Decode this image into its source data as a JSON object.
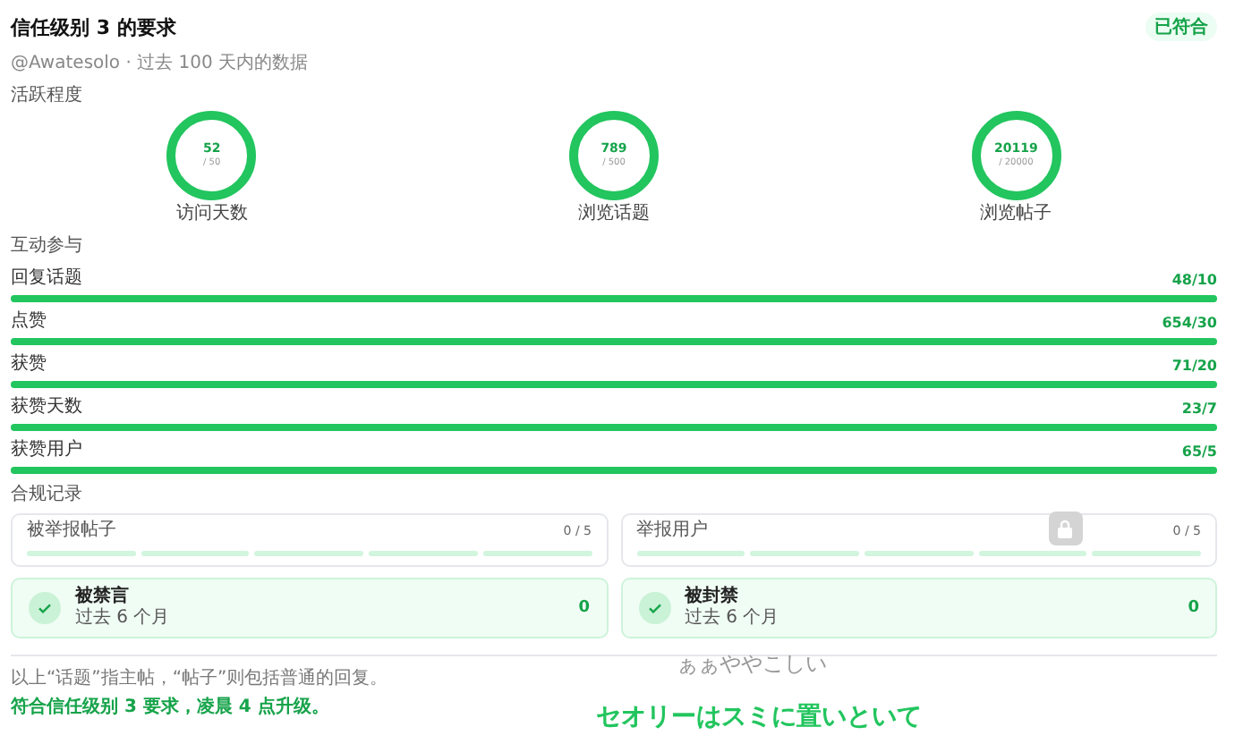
{
  "header": {
    "title": "信任级别 3 的要求",
    "badge": "已符合",
    "subtitle": "@Awatesolo · 过去 100 天内的数据"
  },
  "activity": {
    "heading": "活跃程度",
    "rings": [
      {
        "value": "52",
        "target": "/ 50",
        "label": "访问天数"
      },
      {
        "value": "789",
        "target": "/ 500",
        "label": "浏览话题"
      },
      {
        "value": "20119",
        "target": "/ 20000",
        "label": "浏览帖子"
      }
    ]
  },
  "interaction": {
    "heading": "互动参与",
    "bars": [
      {
        "label": "回复话题",
        "reading": "48/10",
        "level": 1
      },
      {
        "label": "点赞",
        "reading": "654/30",
        "level": 1
      },
      {
        "label": "获赞",
        "reading": "71/20",
        "level": 1
      },
      {
        "label": "获赞天数",
        "reading": "23/7",
        "level": 1
      },
      {
        "label": "获赞用户",
        "reading": "65/5",
        "level": 1
      }
    ]
  },
  "compliance": {
    "heading": "合规记录",
    "reports": [
      {
        "label": "被举报帖子",
        "reading": "0 / 5",
        "locked": false
      },
      {
        "label": "举报用户",
        "reading": "0 / 5",
        "locked": true
      }
    ],
    "penalties": [
      {
        "title": "被禁言",
        "subtitle": "过去 6 个月",
        "count": "0"
      },
      {
        "title": "被封禁",
        "subtitle": "过去 6 个月",
        "count": "0"
      }
    ]
  },
  "footer": {
    "note": "以上“话题”指主帖，“帖子”则包括普通的回复。",
    "result": "符合信任级别 3 要求，凌晨 4 点升级。"
  },
  "lyrics": [
    {
      "text": "ぁぁややこしい",
      "kind": "ghost"
    },
    {
      "text": "セオリーはスミに置いといて",
      "kind": "main"
    }
  ]
}
